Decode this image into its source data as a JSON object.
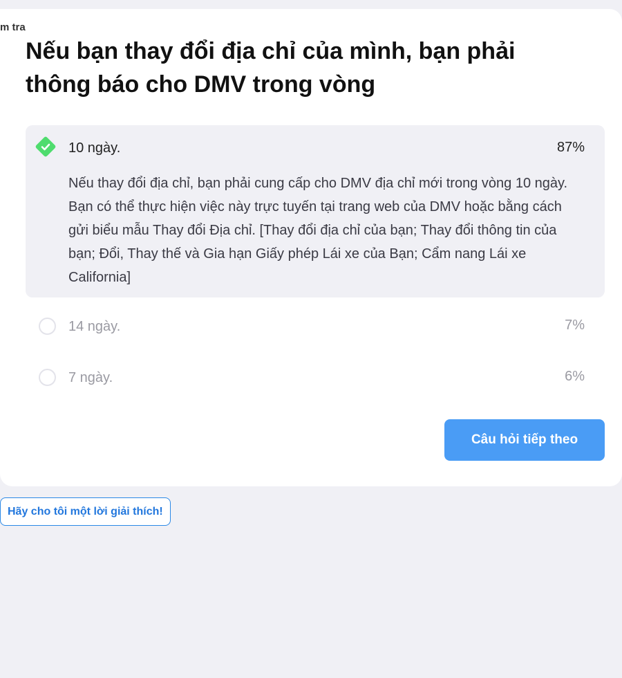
{
  "header": {
    "crumb": "m tra"
  },
  "question": "Nếu bạn thay đổi địa chỉ của mình, bạn phải thông báo cho DMV trong vòng",
  "answers": [
    {
      "label": "10 ngày.",
      "percent": "87%",
      "correct": true,
      "explanation": "Nếu thay đổi địa chỉ, bạn phải cung cấp cho DMV địa chỉ mới trong vòng 10 ngày. Bạn có thể thực hiện việc này trực tuyến tại trang web của DMV hoặc bằng cách gửi biểu mẫu Thay đổi Địa chỉ. [Thay đổi địa chỉ của bạn; Thay đổi thông tin của bạn; Đổi, Thay thế và Gia hạn Giấy phép Lái xe của Bạn; Cẩm nang Lái xe California]"
    },
    {
      "label": "14 ngày.",
      "percent": "7%",
      "correct": false
    },
    {
      "label": "7 ngày.",
      "percent": "6%",
      "correct": false
    }
  ],
  "buttons": {
    "next": "Câu hỏi tiếp theo",
    "explain": "Hãy cho tôi một lời giải thích!"
  },
  "colors": {
    "correct": "#4fdc6e",
    "primary": "#4a9cf5",
    "link": "#2277dd"
  }
}
